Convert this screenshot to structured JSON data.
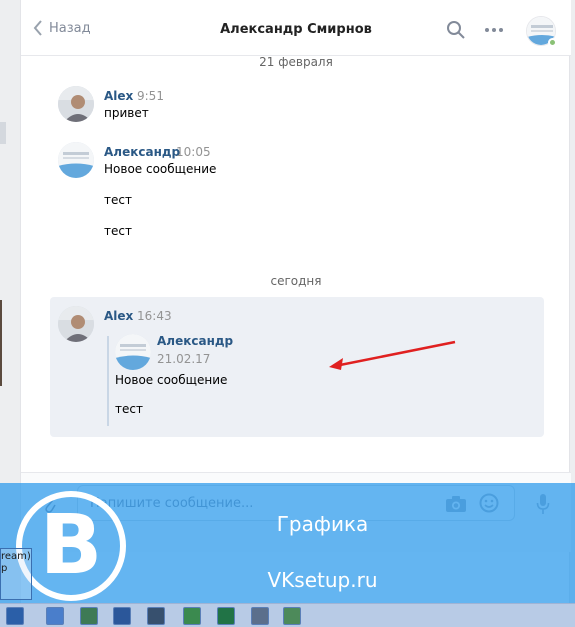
{
  "header": {
    "back_label": "Назад",
    "title": "Александр Смирнов"
  },
  "dates": {
    "first": "21 февраля",
    "second": "сегодня"
  },
  "messages": [
    {
      "name": "Alex",
      "time": "9:51",
      "lines": [
        "привет"
      ]
    },
    {
      "name": "Александр",
      "time": "10:05",
      "lines": [
        "Новое сообщение",
        "тест",
        "тест"
      ]
    }
  ],
  "forwarded": {
    "name": "Alex",
    "time": "16:43",
    "quote": {
      "name": "Александр",
      "date": "21.02.17",
      "lines": [
        "Новое сообщение",
        "тест"
      ]
    }
  },
  "composer": {
    "placeholder": "Напишите сообщение..."
  },
  "watermark": {
    "logo_letter": "B",
    "line1": "Графика",
    "line2": "VKsetup.ru"
  },
  "sidebox": {
    "line1": "ream)",
    "line2": "p"
  },
  "colors": {
    "accent": "#2a5885",
    "overlay": "#2898eb",
    "arrow": "#e02020"
  }
}
